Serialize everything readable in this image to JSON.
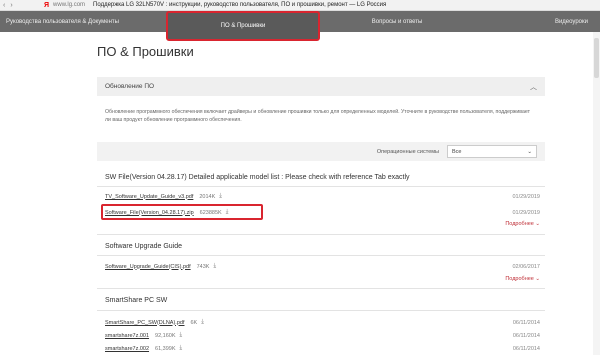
{
  "browser": {
    "url": "www.lg.com",
    "page_title": "Поддержка LG 32LN570V : инструкции, руководство пользователя, ПО и прошивки, ремонт — LG Россия"
  },
  "nav": {
    "items": [
      {
        "label": "Руководства пользователя & Документы"
      },
      {
        "label": "ПО & Прошивки"
      },
      {
        "label": "Вопросы и ответы"
      },
      {
        "label": "Видеоуроки"
      }
    ]
  },
  "page": {
    "title": "ПО & Прошивки"
  },
  "update_panel": {
    "title": "Обновление ПО",
    "description": "Обновление программного обеспечения включает драйверы и обновление прошивки только для определенных моделей. Уточните в руководстве пользователя, поддерживает ли ваш продукт обновление программного обеспечения.",
    "os_label": "Операционные системы",
    "os_value": "Все"
  },
  "sections": [
    {
      "title": "SW File(Version 04.28.17) Detailed applicable model list : Please check with reference Tab exactly",
      "files": [
        {
          "name": "TV_Software_Update_Guide_v3.pdf",
          "size": "2014K",
          "date": "01/29/2019"
        },
        {
          "name": "Software_File(Version_04.28.17).zip",
          "size": "623885K",
          "date": "01/29/2019"
        }
      ],
      "more": "Подробнее"
    },
    {
      "title": "Software Upgrade Guide",
      "files": [
        {
          "name": "Software_Upgrade_Guide(CIS).pdf",
          "size": "743K",
          "date": "02/06/2017"
        }
      ],
      "more": "Подробнее"
    },
    {
      "title": "SmartShare PC SW",
      "files": [
        {
          "name": "SmartShare_PC_SW(DLNA).pdf",
          "size": "6K",
          "date": "06/11/2014"
        },
        {
          "name": "smartshare7z.001",
          "size": "92,160K",
          "date": "06/11/2014"
        },
        {
          "name": "smartshare7z.002",
          "size": "61,399K",
          "date": "06/11/2014"
        }
      ]
    }
  ],
  "colors": {
    "accent": "#c0323a",
    "highlight": "#d9252f",
    "nav_bg": "#6b6b6b"
  }
}
